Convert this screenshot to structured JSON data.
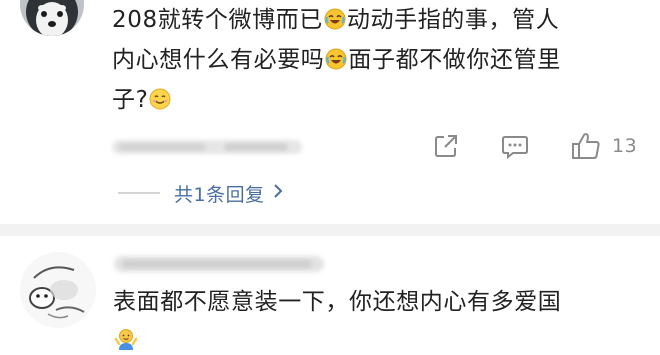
{
  "comment_1": {
    "text_line_1_a": "208就转个微博而已",
    "text_line_1_b": "动动手指的事，管人",
    "text_line_2_a": "内心想什么有必要吗",
    "text_line_2_b": "面子都不做你还管里",
    "text_line_3": "子?",
    "emoji_1": "laugh-cry-emoji",
    "emoji_2": "laugh-cry-emoji",
    "emoji_3": "smile-emoji",
    "like_count": "13"
  },
  "replies": {
    "label": "共1条回复"
  },
  "comment_2": {
    "text": "表面都不愿意装一下，你还想内心有多爱国",
    "emoji": "shrug-emoji"
  },
  "icons": {
    "share": "share-icon",
    "comment": "comment-icon",
    "like": "thumbs-up-icon",
    "reply_chevron": "chevron-right-icon"
  },
  "colors": {
    "link": "#4a6fa0",
    "muted": "#8a8a8a",
    "divider": "#f2f2f2"
  }
}
